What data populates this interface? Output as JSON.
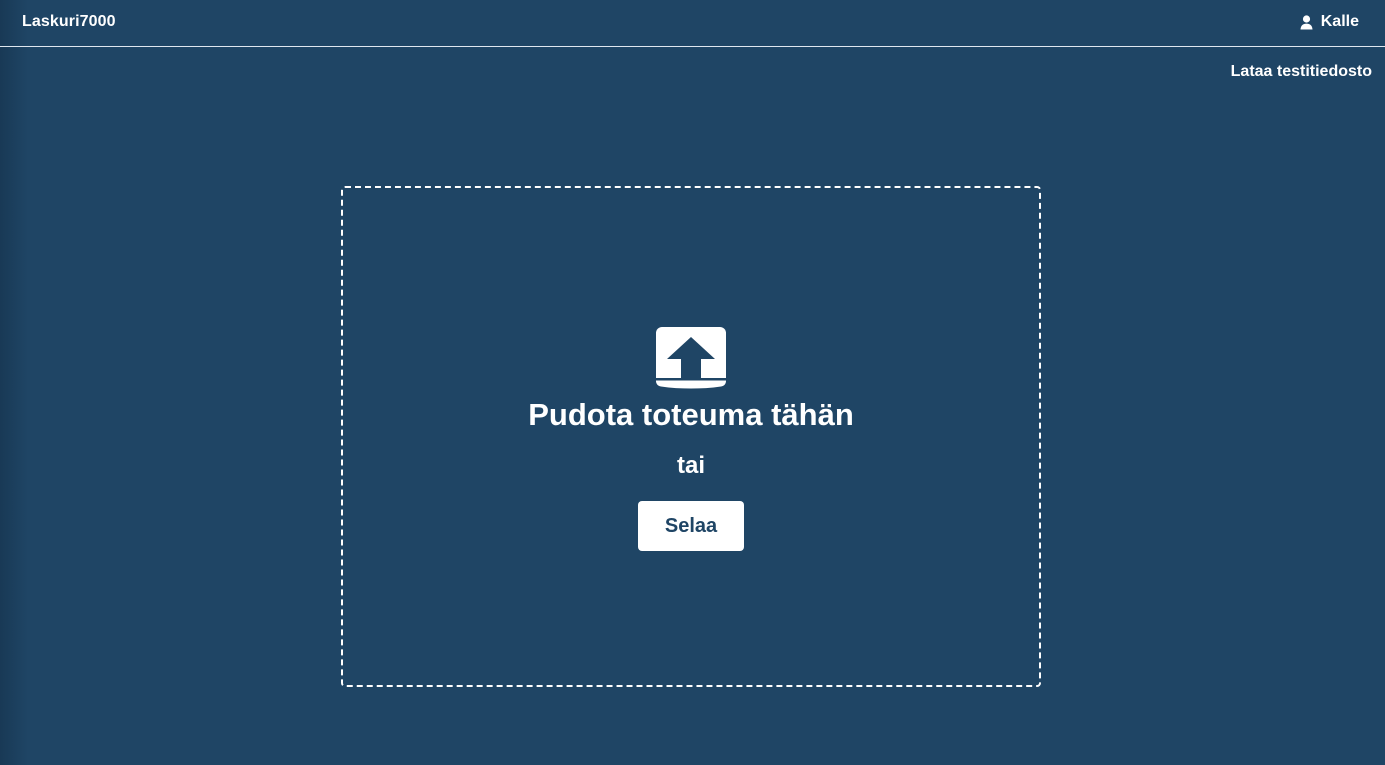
{
  "header": {
    "app_title": "Laskuri7000",
    "user_icon": "user-icon",
    "user_name": "Kalle"
  },
  "links": {
    "test_file": "Lataa testitiedosto"
  },
  "dropzone": {
    "icon": "upload-icon",
    "title": "Pudota toteuma tähän",
    "or_text": "tai",
    "browse_label": "Selaa"
  },
  "colors": {
    "background": "#1f4565",
    "foreground": "#ffffff",
    "button_text": "#1f4565"
  }
}
